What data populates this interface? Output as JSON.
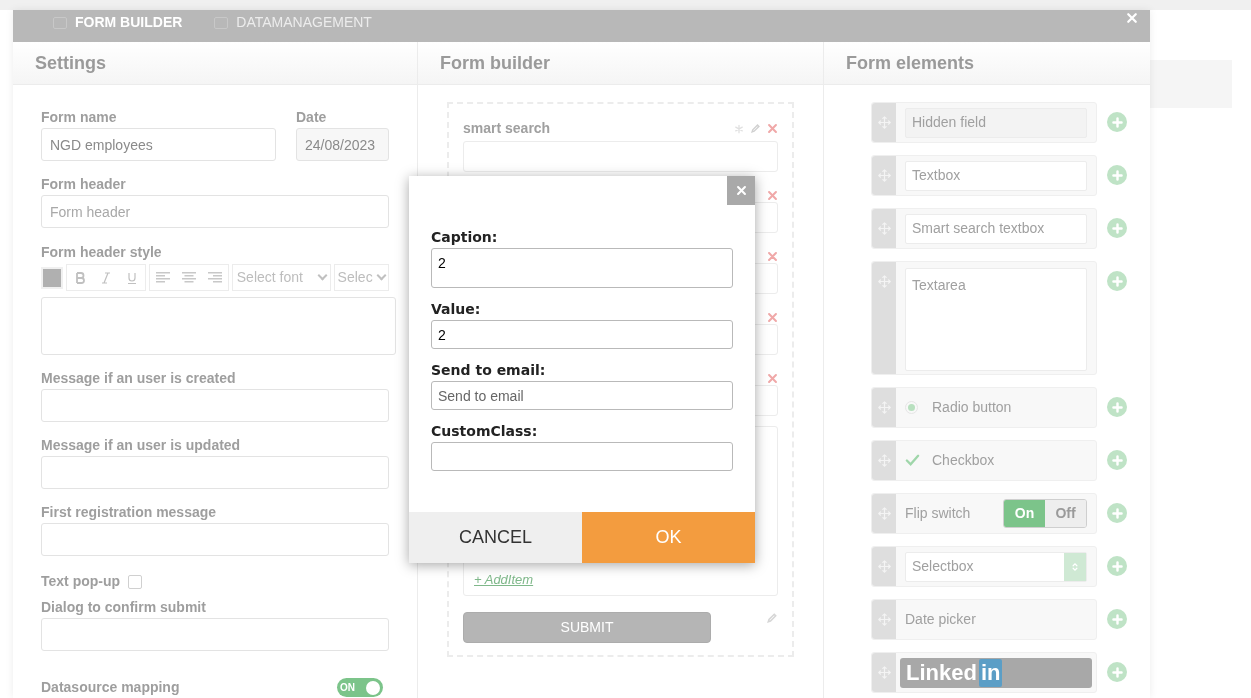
{
  "top_tabs": [
    {
      "label": "FORM BUILDER",
      "selected": true
    },
    {
      "label": "DATAMANAGEMENT",
      "selected": false
    }
  ],
  "settings": {
    "title": "Settings",
    "form_name": {
      "label": "Form name",
      "value": "NGD employees"
    },
    "date": {
      "label": "Date",
      "value": "24/08/2023"
    },
    "form_header": {
      "label": "Form header",
      "placeholder": "Form header"
    },
    "form_header_style": {
      "label": "Form header style",
      "font_select": "Select font",
      "size_select": "Selec"
    },
    "messages": [
      {
        "label": "Message if an user is created"
      },
      {
        "label": "Message if an user is updated"
      },
      {
        "label": "First registration message"
      }
    ],
    "text_popup": {
      "label": "Text pop-up",
      "checked": false
    },
    "confirm_dialog": {
      "label": "Dialog to confirm submit"
    },
    "datasource_mapping": {
      "label": "Datasource mapping",
      "on": true,
      "switch_text": "ON"
    }
  },
  "form_builder": {
    "title": "Form builder",
    "first_field": "smart search",
    "add_item": "+ AddItem",
    "submit": "SUBMIT"
  },
  "form_elements": {
    "title": "Form elements",
    "items": [
      {
        "kind": "input",
        "text": "Hidden field",
        "readonly": true
      },
      {
        "kind": "input",
        "text": "Textbox",
        "readonly": false
      },
      {
        "kind": "input",
        "text": "Smart search textbox",
        "readonly": false
      },
      {
        "kind": "textarea",
        "text": "Textarea"
      },
      {
        "kind": "radio",
        "text": "Radio button"
      },
      {
        "kind": "checkbox",
        "text": "Checkbox"
      },
      {
        "kind": "flip",
        "text": "Flip switch",
        "on_label": "On",
        "off_label": "Off",
        "on": true
      },
      {
        "kind": "select",
        "text": "Selectbox"
      },
      {
        "kind": "plain",
        "text": "Date picker"
      },
      {
        "kind": "linkedin",
        "text": "Linked",
        "badge": "in"
      }
    ]
  },
  "dialog": {
    "fields": [
      {
        "label": "Caption:",
        "value": "2"
      },
      {
        "label": "Value:",
        "value": "2"
      },
      {
        "label": "Send to email:",
        "placeholder": "Send to email"
      },
      {
        "label": "CustomClass:"
      }
    ],
    "cancel": "CANCEL",
    "ok": "OK"
  }
}
